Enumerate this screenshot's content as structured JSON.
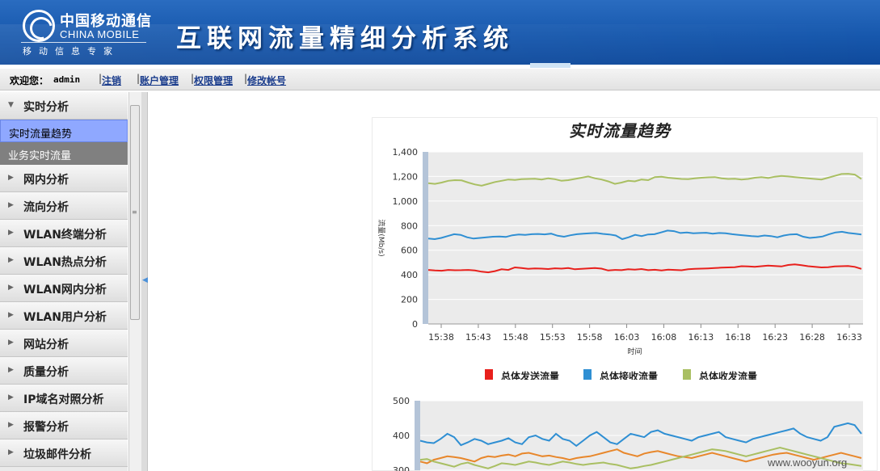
{
  "header": {
    "logo_cn": "中国移动通信",
    "logo_en": "CHINA MOBILE",
    "logo_sub": "移动信息专家",
    "system_title": "互联网流量精细分析系统"
  },
  "navbar": {
    "welcome_label": "欢迎您：",
    "username": "admin",
    "links": [
      {
        "label": "注销"
      },
      {
        "label": "账户管理"
      },
      {
        "label": "权限管理"
      },
      {
        "label": "修改帐号"
      }
    ]
  },
  "sidebar": {
    "sections": [
      {
        "label": "实时分析",
        "expanded": true
      },
      {
        "label": "网内分析"
      },
      {
        "label": "流向分析"
      },
      {
        "label": "WLAN终端分析"
      },
      {
        "label": "WLAN热点分析"
      },
      {
        "label": "WLAN网内分析"
      },
      {
        "label": "WLAN用户分析"
      },
      {
        "label": "网站分析"
      },
      {
        "label": "质量分析"
      },
      {
        "label": "IP域名对照分析"
      },
      {
        "label": "报警分析"
      },
      {
        "label": "垃圾邮件分析"
      }
    ],
    "subitems": [
      {
        "label": "实时流量趋势",
        "active": true
      },
      {
        "label": "业务实时流量",
        "active": false
      }
    ]
  },
  "watermark": "www.wooyun.org",
  "colors": {
    "send": "#e8201c",
    "receive": "#2f8fd3",
    "total": "#a9bf62"
  },
  "chart_data": [
    {
      "type": "line",
      "title": "实时流量趋势",
      "xlabel": "时间",
      "ylabel": "流量(Mb/s)",
      "ylim": [
        0,
        1400
      ],
      "yticks": [
        "0",
        "200",
        "400",
        "600",
        "800",
        "1,000",
        "1,200",
        "1,400"
      ],
      "xticks": [
        "15:38",
        "15:43",
        "15:48",
        "15:53",
        "15:58",
        "16:03",
        "16:08",
        "16:13",
        "16:18",
        "16:23",
        "16:28",
        "16:33"
      ],
      "legend_position": "bottom",
      "series": [
        {
          "name": "总体发送流量",
          "color": "#e8201c",
          "values": [
            440,
            435,
            433,
            440,
            437,
            438,
            440,
            435,
            425,
            420,
            430,
            445,
            440,
            460,
            455,
            448,
            452,
            450,
            447,
            453,
            450,
            455,
            445,
            448,
            452,
            455,
            450,
            435,
            440,
            438,
            445,
            442,
            447,
            438,
            441,
            436,
            442,
            440,
            437,
            445,
            448,
            450,
            452,
            455,
            458,
            460,
            462,
            470,
            468,
            465,
            470,
            475,
            472,
            468,
            480,
            485,
            478,
            470,
            465,
            460,
            462,
            468,
            470,
            472,
            465,
            448
          ]
        },
        {
          "name": "总体接收流量",
          "color": "#2f8fd3",
          "values": [
            695,
            690,
            700,
            715,
            730,
            725,
            705,
            695,
            700,
            705,
            710,
            712,
            708,
            722,
            728,
            725,
            730,
            732,
            729,
            735,
            718,
            710,
            722,
            730,
            735,
            738,
            740,
            733,
            728,
            720,
            690,
            705,
            725,
            715,
            728,
            730,
            745,
            760,
            755,
            740,
            745,
            738,
            740,
            742,
            735,
            740,
            738,
            730,
            725,
            720,
            715,
            712,
            720,
            715,
            705,
            720,
            728,
            730,
            710,
            700,
            705,
            712,
            730,
            745,
            750,
            740,
            735,
            728
          ]
        },
        {
          "name": "总体收发流量",
          "color": "#a9bf62",
          "values": [
            1145,
            1140,
            1150,
            1165,
            1170,
            1168,
            1150,
            1135,
            1125,
            1140,
            1155,
            1165,
            1175,
            1172,
            1178,
            1180,
            1182,
            1175,
            1185,
            1178,
            1165,
            1170,
            1180,
            1190,
            1200,
            1185,
            1175,
            1160,
            1140,
            1150,
            1165,
            1160,
            1175,
            1170,
            1195,
            1198,
            1190,
            1185,
            1180,
            1178,
            1185,
            1190,
            1193,
            1195,
            1185,
            1180,
            1182,
            1175,
            1180,
            1190,
            1195,
            1188,
            1198,
            1205,
            1200,
            1195,
            1190,
            1185,
            1180,
            1175,
            1190,
            1205,
            1220,
            1222,
            1215,
            1180
          ]
        }
      ]
    },
    {
      "type": "line",
      "title": "",
      "ylim": [
        300,
        500
      ],
      "yticks": [
        "300",
        "400",
        "500"
      ],
      "series": [
        {
          "name": "",
          "color": "#2f8fd3",
          "values": [
            385,
            380,
            378,
            390,
            405,
            395,
            372,
            380,
            390,
            385,
            375,
            380,
            385,
            392,
            380,
            375,
            395,
            400,
            390,
            385,
            405,
            390,
            385,
            370,
            385,
            400,
            410,
            395,
            380,
            375,
            390,
            405,
            400,
            395,
            410,
            415,
            405,
            400,
            395,
            390,
            385,
            395,
            400,
            405,
            410,
            395,
            390,
            385,
            380,
            390,
            395,
            400,
            405,
            410,
            415,
            420,
            405,
            395,
            390,
            385,
            395,
            425,
            430,
            435,
            430,
            405
          ]
        },
        {
          "name": "",
          "color": "#e8872b",
          "values": [
            325,
            320,
            330,
            335,
            340,
            338,
            335,
            330,
            325,
            335,
            340,
            338,
            342,
            345,
            340,
            348,
            350,
            345,
            340,
            342,
            338,
            335,
            330,
            335,
            338,
            340,
            345,
            350,
            355,
            360,
            350,
            345,
            340,
            348,
            352,
            355,
            350,
            345,
            340,
            338,
            335,
            340,
            345,
            350,
            345,
            340,
            335,
            330,
            325,
            330,
            335,
            340,
            345,
            348,
            350,
            345,
            340,
            335,
            330,
            335,
            340,
            345,
            350,
            345,
            340,
            335
          ]
        },
        {
          "name": "",
          "color": "#a9bf62",
          "values": [
            330,
            332,
            325,
            320,
            315,
            310,
            318,
            322,
            315,
            310,
            305,
            312,
            320,
            318,
            315,
            320,
            325,
            322,
            318,
            315,
            320,
            325,
            322,
            318,
            315,
            318,
            320,
            322,
            318,
            315,
            310,
            305,
            308,
            312,
            315,
            320,
            325,
            330,
            335,
            340,
            345,
            350,
            355,
            360,
            358,
            355,
            350,
            345,
            340,
            345,
            350,
            355,
            360,
            365,
            360,
            355,
            350,
            345,
            340,
            335,
            330,
            325,
            320,
            318,
            315,
            312
          ]
        }
      ]
    }
  ]
}
